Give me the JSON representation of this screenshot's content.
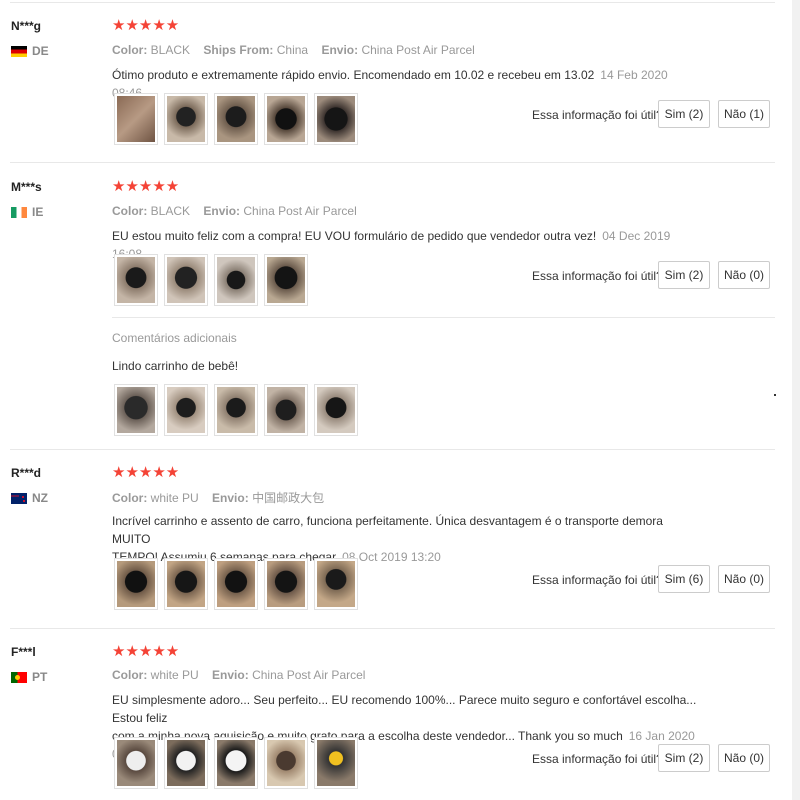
{
  "labels": {
    "helpful_question": "Essa informação foi útil?",
    "color": "Color:",
    "ships_from": "Ships From:",
    "envio": "Envio:",
    "additional_comments": "Comentários adicionais"
  },
  "reviews": [
    {
      "user": "N***g",
      "country": "DE",
      "stars": "★★★★★",
      "color": "BLACK",
      "ships_from": "China",
      "envio": "China Post Air Parcel",
      "text": "Ótimo produto e extremamente rápido envio. Encomendado em 10.02 e recebeu em 13.02",
      "date": "14 Feb 2020 08:46",
      "yes": "Sim (2)",
      "no": "Não (1)",
      "thumbs": [
        "photo-box",
        "photo-stroller",
        "photo-stroller",
        "photo-stroller",
        "photo-stroller"
      ]
    },
    {
      "user": "M***s",
      "country": "IE",
      "stars": "★★★★★",
      "color": "BLACK",
      "envio": "China Post Air Parcel",
      "text": "EU estou muito feliz com a compra! EU VOU formulário de pedido que vendedor outra vez!",
      "date": "04 Dec 2019 16:08",
      "yes": "Sim (2)",
      "no": "Não (0)",
      "thumbs": [
        "photo-stroller",
        "photo-stroller",
        "photo-stroller",
        "photo-stroller"
      ],
      "additional": {
        "text": "Lindo carrinho de bebê!",
        "thumbs": [
          "photo-carseat",
          "photo-stroller",
          "photo-stroller",
          "photo-stroller",
          "photo-stroller"
        ]
      }
    },
    {
      "user": "R***d",
      "country": "NZ",
      "stars": "★★★★★",
      "color": "white PU",
      "envio": "中国邮政大包",
      "text_line1": "Incrível carrinho e assento de carro, funciona perfeitamente. Única desvantagem é o transporte demora MUITO",
      "text_line2": "TEMPO! Assumiu 6 semanas para chegar",
      "date": "08 Oct 2019 13:20",
      "yes": "Sim (6)",
      "no": "Não (0)",
      "thumbs": [
        "photo-stroller",
        "photo-stroller",
        "photo-stroller",
        "photo-stroller",
        "photo-stroller"
      ]
    },
    {
      "user": "F***l",
      "country": "PT",
      "stars": "★★★★★",
      "color": "white PU",
      "envio": "China Post Air Parcel",
      "text_line1": "EU simplesmente adoro... Seu perfeito... EU recomendo 100%... Parece muito seguro e confortável escolha... Estou feliz",
      "text_line2": "com a minha nova aquisição e muito grato para a escolha deste vendedor... Thank you so much",
      "date": "16 Jan 2020 04:47",
      "yes": "Sim (2)",
      "no": "Não (0)",
      "thumbs": [
        "photo-stroller-white",
        "photo-stroller-white",
        "photo-stroller-white",
        "photo-stroller",
        "photo-stroller"
      ]
    }
  ]
}
